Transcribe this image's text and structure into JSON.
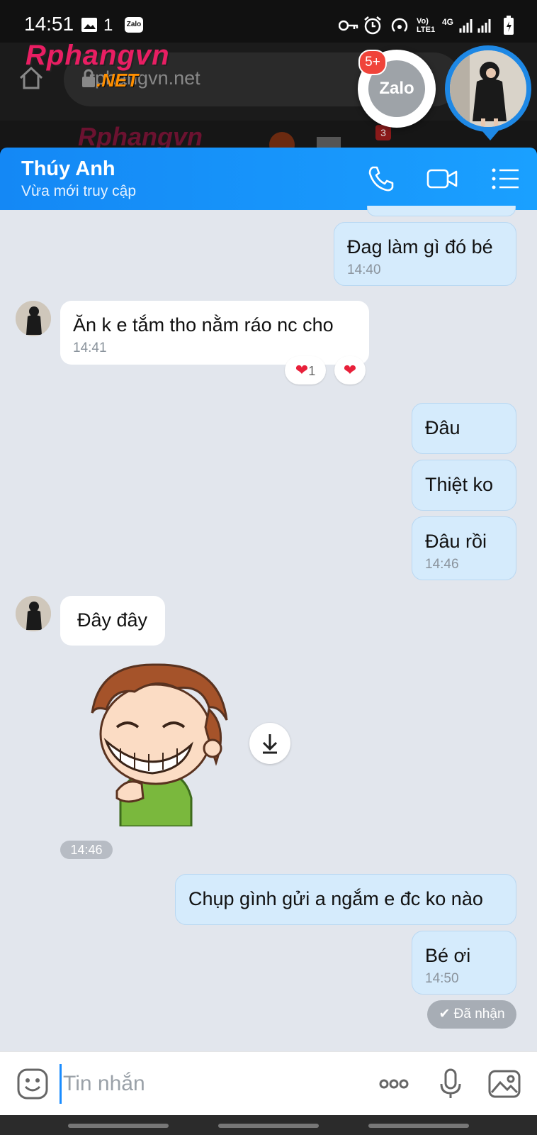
{
  "status_bar": {
    "time": "14:51",
    "notif_count": "1",
    "notif_app": "Zalo",
    "network": "Vo) LTE1",
    "network_type": "4G"
  },
  "browser": {
    "url": "rphangvn.net",
    "logo_main": "Rphangvn",
    "logo_suffix": ".NET",
    "site_logo": "Rphangvn",
    "site_notif_count": "3"
  },
  "chat_heads": {
    "app_label": "Zalo",
    "badge": "5+"
  },
  "header": {
    "contact_name": "Thúy Anh",
    "status": "Vừa mới truy cập"
  },
  "messages": [
    {
      "dir": "out",
      "text": "Đag làm gì đó bé",
      "time": "14:40"
    },
    {
      "dir": "in",
      "text": "Ăn k e tắm tho nằm ráo nc cho",
      "time": "14:41",
      "reaction_count": "1"
    },
    {
      "dir": "out",
      "text": "Đâu"
    },
    {
      "dir": "out",
      "text": "Thiệt ko"
    },
    {
      "dir": "out",
      "text": "Đâu rồi",
      "time": "14:46"
    },
    {
      "dir": "in",
      "text": "Đây đây"
    },
    {
      "dir": "in",
      "type": "sticker",
      "time": "14:46"
    },
    {
      "dir": "out",
      "text": "Chụp gình gửi a ngắm e đc ko nào"
    },
    {
      "dir": "out",
      "text": "Bé ơi",
      "time": "14:50"
    }
  ],
  "receipt": "Đã nhận",
  "input": {
    "placeholder": "Tin nhắn"
  },
  "colors": {
    "header_blue": "#1488f5",
    "out_bubble": "#d5ebfc",
    "chat_bg": "#e2e6ed",
    "heart": "#e8203a"
  }
}
